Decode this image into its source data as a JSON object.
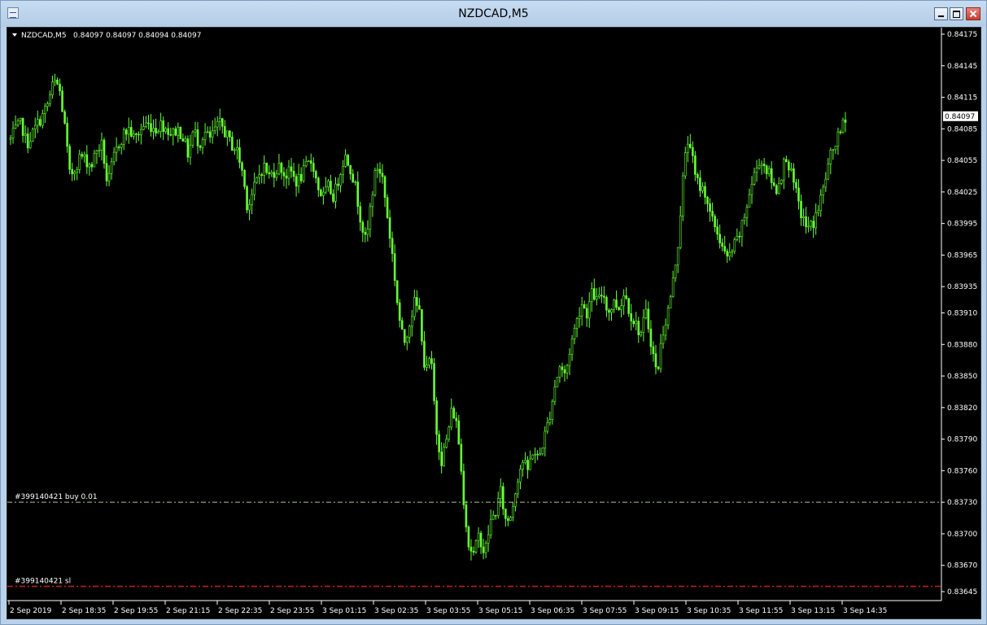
{
  "window": {
    "title": "NZDCAD,M5"
  },
  "chart_data": {
    "type": "candlestick",
    "symbol": "NZDCAD,M5",
    "ohlc": "0.84097 0.84097 0.84094 0.84097",
    "current_price": "0.84097",
    "colors": {
      "background": "#000000",
      "candle": "#66ff33",
      "axis": "#ffffff",
      "order_line": "#a8c890",
      "sl_line": "#c81e1e"
    },
    "ylim": [
      0.83645,
      0.84175
    ],
    "y_ticks": [
      "0.84175",
      "0.84145",
      "0.84115",
      "0.84085",
      "0.84055",
      "0.84025",
      "0.83995",
      "0.83965",
      "0.83935",
      "0.83910",
      "0.83880",
      "0.83850",
      "0.83820",
      "0.83790",
      "0.83760",
      "0.83730",
      "0.83700",
      "0.83670",
      "0.83645"
    ],
    "x_ticks": [
      "2 Sep 2019",
      "2 Sep 18:35",
      "2 Sep 19:55",
      "2 Sep 21:15",
      "2 Sep 22:35",
      "2 Sep 23:55",
      "3 Sep 01:15",
      "3 Sep 02:35",
      "3 Sep 03:55",
      "3 Sep 05:15",
      "3 Sep 06:35",
      "3 Sep 07:55",
      "3 Sep 09:15",
      "3 Sep 10:35",
      "3 Sep 11:55",
      "3 Sep 13:15",
      "3 Sep 14:35"
    ],
    "orders": [
      {
        "label": "#399140421 buy 0.01",
        "price": 0.8373,
        "kind": "buy"
      },
      {
        "label": "#399140421 sl",
        "price": 0.8365,
        "kind": "sl"
      }
    ],
    "close_path": [
      0.84075,
      0.84085,
      0.8409,
      0.8407,
      0.8408,
      0.8409,
      0.84098,
      0.8411,
      0.8413,
      0.84125,
      0.8409,
      0.8404,
      0.84048,
      0.8406,
      0.84055,
      0.8405,
      0.84065,
      0.8407,
      0.8403,
      0.84055,
      0.8407,
      0.8408,
      0.84085,
      0.84075,
      0.84083,
      0.8409,
      0.84088,
      0.84085,
      0.8409,
      0.84085,
      0.8408,
      0.84085,
      0.84078,
      0.8406,
      0.84085,
      0.8407,
      0.84082,
      0.84075,
      0.84085,
      0.8409,
      0.8408,
      0.8407,
      0.84065,
      0.84045,
      0.8401,
      0.84025,
      0.8404,
      0.8405,
      0.8404,
      0.84045,
      0.8405,
      0.8404,
      0.84045,
      0.84035,
      0.8404,
      0.8405,
      0.84055,
      0.8403,
      0.8402,
      0.8403,
      0.8402,
      0.8404,
      0.8406,
      0.8405,
      0.8403,
      0.84,
      0.83975,
      0.8402,
      0.8405,
      0.8404,
      0.84,
      0.8396,
      0.8391,
      0.8388,
      0.839,
      0.8392,
      0.8391,
      0.8385,
      0.8387,
      0.838,
      0.8377,
      0.8379,
      0.8382,
      0.838,
      0.8374,
      0.8369,
      0.8368,
      0.837,
      0.8368,
      0.8371,
      0.8372,
      0.8374,
      0.8371,
      0.8372,
      0.8375,
      0.8377,
      0.8376,
      0.8378,
      0.8377,
      0.8379,
      0.8381,
      0.8384,
      0.8386,
      0.8385,
      0.8388,
      0.839,
      0.8392,
      0.8391,
      0.8393,
      0.8392,
      0.8393,
      0.8391,
      0.8392,
      0.83915,
      0.8393,
      0.8391,
      0.839,
      0.8389,
      0.8391,
      0.8388,
      0.8385,
      0.8389,
      0.8391,
      0.8394,
      0.8398,
      0.8405,
      0.8408,
      0.8404,
      0.8403,
      0.84025,
      0.84,
      0.8399,
      0.83975,
      0.8396,
      0.8397,
      0.8398,
      0.83995,
      0.8402,
      0.8404,
      0.84055,
      0.8405,
      0.8404,
      0.84025,
      0.8404,
      0.8406,
      0.8404,
      0.8402,
      0.84,
      0.8399,
      0.83995,
      0.8401,
      0.8403,
      0.84055,
      0.8407,
      0.8408,
      0.84097
    ]
  }
}
